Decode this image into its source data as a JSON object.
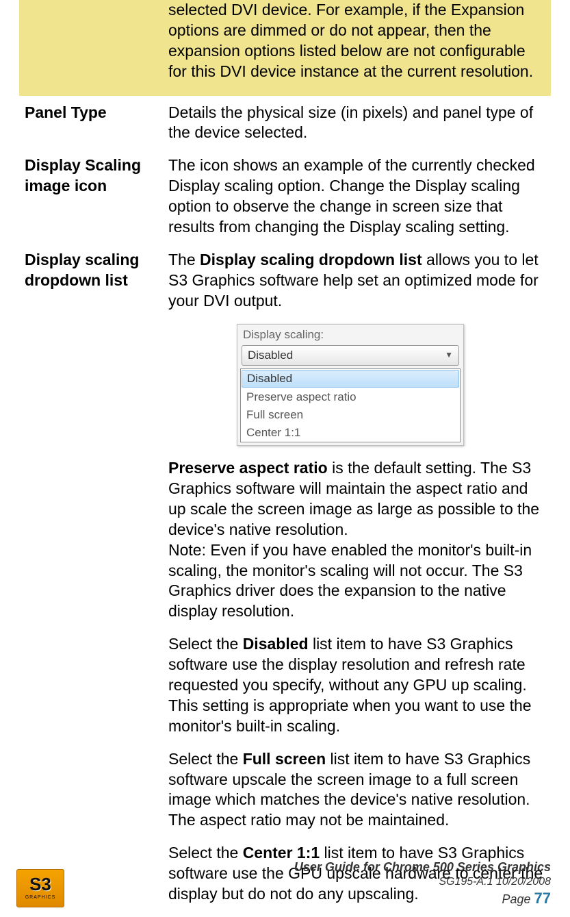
{
  "note_box": {
    "label": "",
    "text": "selected DVI device. For example, if the Expansion options are dimmed or do not appear, then the expansion options listed below are not configurable for this DVI device instance at the current resolution."
  },
  "rows": {
    "panel_type": {
      "label": "Panel Type",
      "text": "Details the physical size (in pixels) and panel type of the device selected."
    },
    "image_icon": {
      "label": "Display Scaling image icon",
      "text": "The icon shows an example of the currently checked Display scaling option. Change the Display scaling option to observe the change in screen size that results from changing the Display scaling setting."
    },
    "dropdown": {
      "label": "Display scaling dropdown list",
      "intro_prefix": "The ",
      "intro_bold": "Display scaling dropdown list",
      "intro_suffix": " allows you to let S3 Graphics software help set an optimized mode for your DVI output.",
      "preserve_bold": "Preserve aspect ratio",
      "preserve_text": " is the default setting. The S3 Graphics software will maintain the aspect ratio and up scale the screen image as large as possible to the device's native resolution.",
      "preserve_note": "Note: Even if you have enabled the monitor's built-in scaling, the monitor's scaling will not occur. The S3 Graphics driver does the expansion to the native display resolution.",
      "disabled_prefix": "Select the ",
      "disabled_bold": "Disabled",
      "disabled_suffix": " list item to have S3 Graphics software use the display resolution and refresh rate requested you specify, without any GPU up scaling. This setting is appropriate when you want to use the monitor's built-in scaling.",
      "full_prefix": "Select the ",
      "full_bold": "Full screen",
      "full_suffix": " list item to have S3 Graphics software upscale the screen image to a full screen image which matches the device's native resolution. The aspect ratio may not be maintained.",
      "center_prefix": "Select the ",
      "center_bold": "Center 1:1",
      "center_suffix": " list item to have S3 Graphics software use the GPU upscale hardware to center the display but do not do any upscaling."
    }
  },
  "dropdown_widget": {
    "label": "Display scaling:",
    "selected": "Disabled",
    "items": [
      "Disabled",
      "Preserve aspect ratio",
      "Full screen",
      "Center 1:1"
    ]
  },
  "footer": {
    "logo_main": "S3",
    "logo_sub": "GRAPHICS",
    "title": "User Guide for Chrome 500 Series Graphics",
    "sg": "SG195-A.1   10/20/2008",
    "page_label": "Page ",
    "page_num": "77"
  }
}
